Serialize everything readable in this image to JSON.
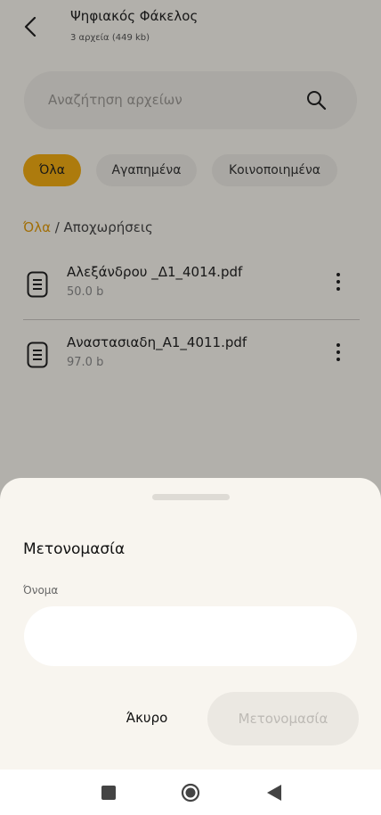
{
  "header": {
    "title": "Ψηφιακός Φάκελος",
    "subtitle": "3 αρχεία (449 kb)"
  },
  "search": {
    "placeholder": "Αναζήτηση αρχείων"
  },
  "filters": [
    {
      "label": "Όλα",
      "active": true
    },
    {
      "label": "Αγαπημένα",
      "active": false
    },
    {
      "label": "Κοινοποιημένα",
      "active": false
    }
  ],
  "breadcrumb": {
    "root": "Όλα",
    "separator": " / ",
    "current": "Αποχωρήσεις"
  },
  "files": [
    {
      "name": "Αλεξάνδρου _Δ1_4014.pdf",
      "size": "50.0 b"
    },
    {
      "name": "Αναστασιαδη_Α1_4011.pdf",
      "size": "97.0 b"
    }
  ],
  "dialog": {
    "title": "Μετονομασία",
    "field_label": "Όνομα",
    "field_value": "",
    "cancel_label": "Άκυρο",
    "confirm_label": "Μετονομασία"
  },
  "icons": {
    "back": "back-arrow-icon",
    "search": "search-icon",
    "file": "document-icon",
    "more": "more-vertical-icon",
    "nav_recent": "square-icon",
    "nav_home": "circle-icon",
    "nav_back": "triangle-back-icon"
  },
  "colors": {
    "accent": "#f0ab12",
    "background": "#f7f4ee",
    "chip": "#ebe8e2"
  }
}
